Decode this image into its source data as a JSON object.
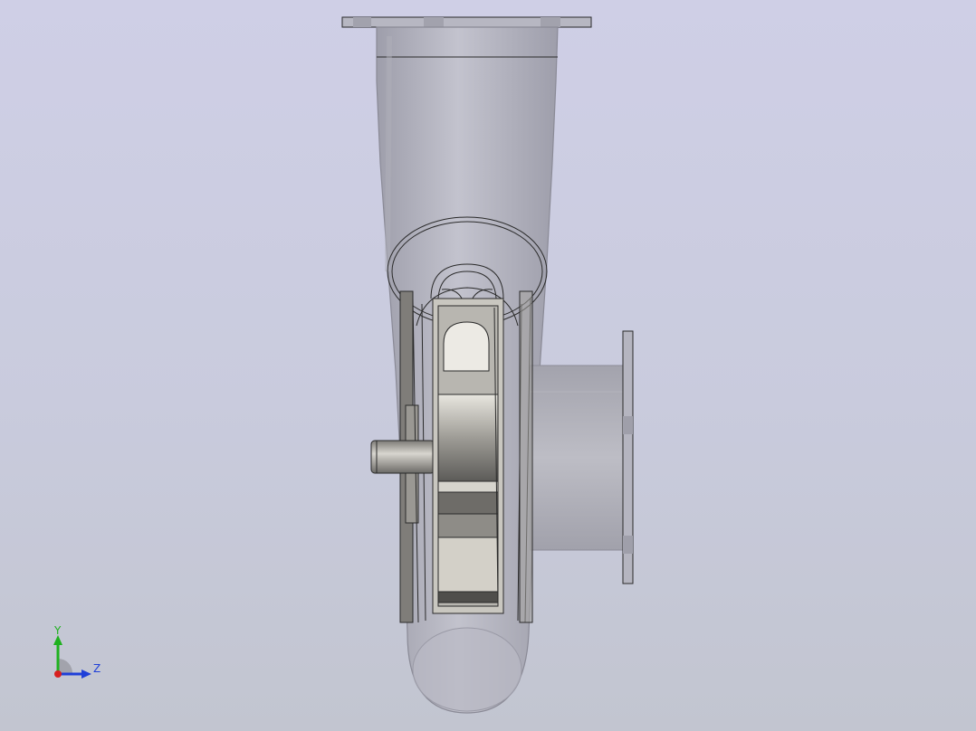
{
  "view": {
    "background_top": "#cfcfe6",
    "background_bottom": "#c2c5d0",
    "model_color": "#a9a9b4",
    "edge_color": "#2a2a2a"
  },
  "triad": {
    "y_label": "Y",
    "z_label": "Z",
    "y_color": "#1fb11f",
    "z_color": "#1f3fd8",
    "x_color": "#d81f1f"
  }
}
